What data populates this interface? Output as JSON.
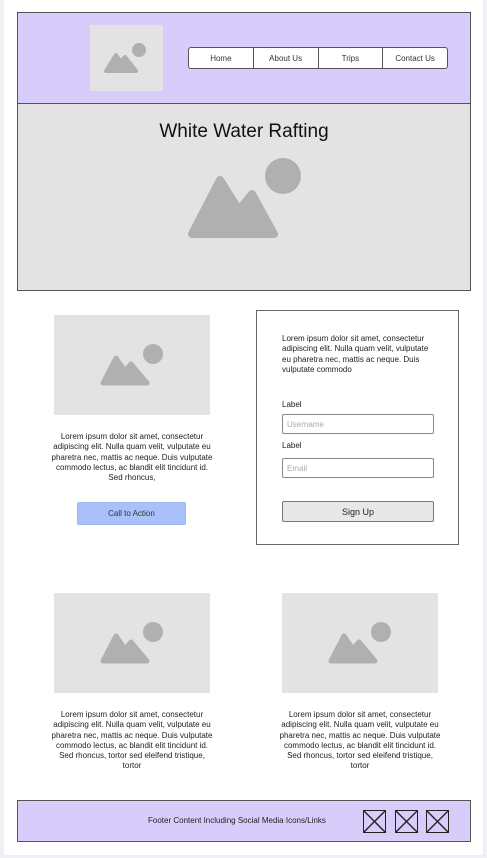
{
  "nav": {
    "items": [
      {
        "label": "Home"
      },
      {
        "label": "About Us"
      },
      {
        "label": "Trips"
      },
      {
        "label": "Contact Us"
      }
    ]
  },
  "hero": {
    "title": "White Water Rafting"
  },
  "feature_left": {
    "text": "Lorem ipsum dolor sit amet, consectetur adipiscing elit. Nulla quam velit, vulputate eu pharetra nec, mattis ac neque. Duis vulputate commodo lectus, ac blandit elit tincidunt id. Sed rhoncus,",
    "cta_label": "Call to Action"
  },
  "signup_form": {
    "text": "Lorem ipsum dolor sit amet, consectetur adipiscing elit. Nulla quam velit, vulputate eu pharetra nec, mattis ac neque. Duis vulputate commodo",
    "username_label": "Label",
    "username_placeholder": "Username",
    "email_label": "Label",
    "email_placeholder": "Email",
    "submit_label": "Sign Up"
  },
  "cards": [
    {
      "text": "Lorem ipsum dolor sit amet, consectetur adipiscing elit. Nulla quam velit, vulputate eu pharetra nec, mattis ac neque. Duis vulputate commodo lectus, ac blandit elit tincidunt id. Sed rhoncus, tortor sed eleifend tristique, tortor"
    },
    {
      "text": "Lorem ipsum dolor sit amet, consectetur adipiscing elit. Nulla quam velit, vulputate eu pharetra nec, mattis ac neque. Duis vulputate commodo lectus, ac blandit elit tincidunt id. Sed rhoncus, tortor sed eleifend tristique, tortor"
    }
  ],
  "footer": {
    "text": "Footer Content Including Social Media Icons/Links",
    "social_icons": [
      "social-link-1-icon",
      "social-link-2-icon",
      "social-link-3-icon"
    ]
  },
  "colors": {
    "header_bg": "#d8ccfb",
    "footer_bg": "#d8ccfb",
    "placeholder_bg": "#e3e3e3",
    "placeholder_icon": "#b0b0b0",
    "cta_bg": "#a9c1fb"
  }
}
